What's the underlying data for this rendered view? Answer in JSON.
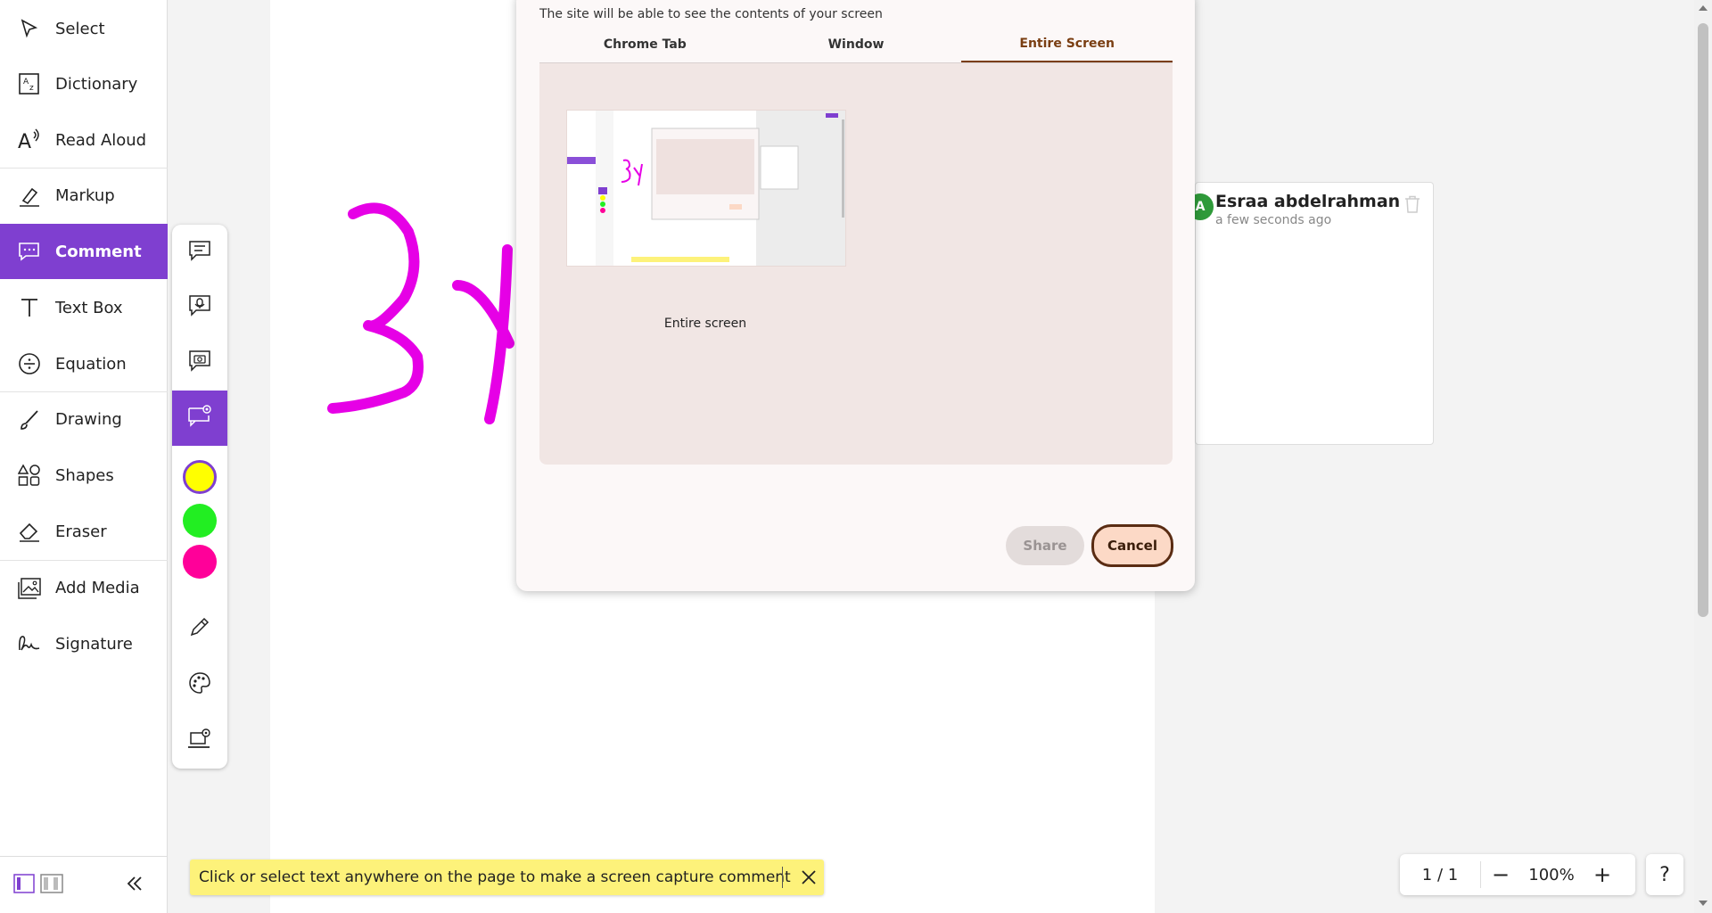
{
  "sidebar": {
    "items": [
      {
        "label": "Select",
        "icon": "cursor-icon"
      },
      {
        "label": "Dictionary",
        "icon": "dictionary-icon"
      },
      {
        "label": "Read Aloud",
        "icon": "read-aloud-icon"
      },
      {
        "label": "Markup",
        "icon": "highlighter-icon"
      },
      {
        "label": "Comment",
        "icon": "comment-icon"
      },
      {
        "label": "Text Box",
        "icon": "text-icon"
      },
      {
        "label": "Equation",
        "icon": "divide-icon"
      },
      {
        "label": "Drawing",
        "icon": "brush-icon"
      },
      {
        "label": "Shapes",
        "icon": "shapes-icon"
      },
      {
        "label": "Eraser",
        "icon": "eraser-icon"
      },
      {
        "label": "Add Media",
        "icon": "image-icon"
      },
      {
        "label": "Signature",
        "icon": "signature-icon"
      }
    ],
    "active": "Comment"
  },
  "subtoolbar": {
    "colors": [
      "#ffff00",
      "#22ee22",
      "#ff0099"
    ],
    "selected_color": "#ffff00"
  },
  "dialog": {
    "subtitle": "The site will be able to see the contents of your screen",
    "tabs": [
      "Chrome Tab",
      "Window",
      "Entire Screen"
    ],
    "active_tab": "Entire Screen",
    "thumbnail_label": "Entire screen",
    "share_label": "Share",
    "cancel_label": "Cancel"
  },
  "comment_card": {
    "avatar_initial": "A",
    "author": "Esraa abdelrahman",
    "time": "a few seconds ago"
  },
  "toast": {
    "message": "Click or select text anywhere on the page to make a screen capture comment"
  },
  "zoombar": {
    "page": "1 / 1",
    "zoom": "100%",
    "minus": "−",
    "plus": "+"
  },
  "help": "?",
  "colors": {
    "accent": "#7f3fd0",
    "ink": "#e600e6"
  }
}
